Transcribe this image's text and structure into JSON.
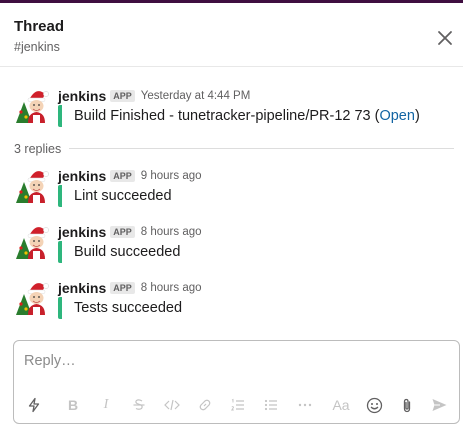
{
  "thread": {
    "title": "Thread",
    "channel": "#jenkins"
  },
  "parent": {
    "sender": "jenkins",
    "badge": "APP",
    "timestamp": "Yesterday at 4:44 PM",
    "text": "Build Finished - tunetracker-pipeline/PR-12 73 (",
    "link": "Open",
    "text_after": ")",
    "accent_color": "#2eb67d"
  },
  "replies_label": "3 replies",
  "replies": [
    {
      "sender": "jenkins",
      "badge": "APP",
      "timestamp": "9 hours ago",
      "text": "Lint succeeded"
    },
    {
      "sender": "jenkins",
      "badge": "APP",
      "timestamp": "8 hours ago",
      "text": "Build succeeded"
    },
    {
      "sender": "jenkins",
      "badge": "APP",
      "timestamp": "8 hours ago",
      "text": "Tests succeeded"
    }
  ],
  "composer": {
    "placeholder": "Reply…",
    "toolbar_icons": [
      "lightning-icon",
      "bold-icon",
      "italic-icon",
      "strikethrough-icon",
      "code-icon",
      "link-icon",
      "ordered-list-icon",
      "bulleted-list-icon",
      "more-icon",
      "text-format-icon",
      "emoji-icon",
      "attachment-icon",
      "send-icon"
    ],
    "bold_glyph": "B",
    "italic_glyph": "I",
    "format_glyph": "Aa"
  },
  "colors": {
    "accent": "#2eb67d",
    "link": "#1264a3",
    "top_strip": "#3f0e40"
  }
}
